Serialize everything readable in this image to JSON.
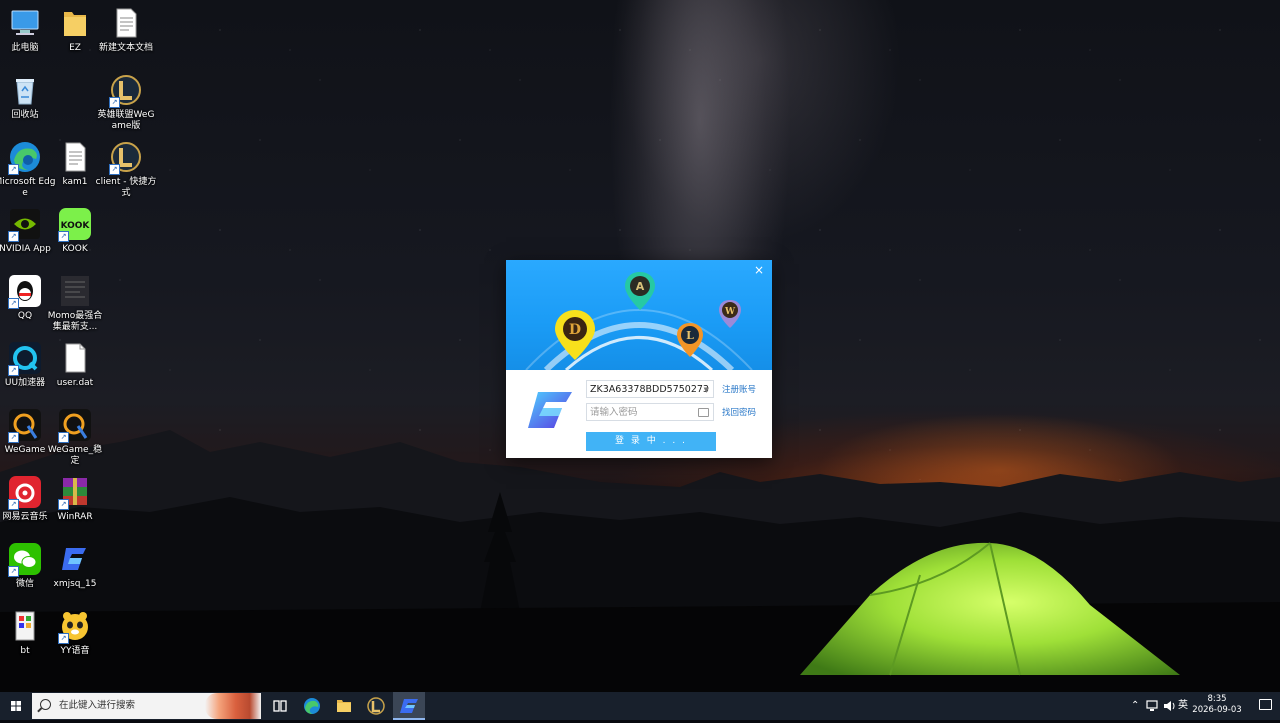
{
  "desktop": {
    "icons": [
      {
        "label": "此电脑",
        "icon": "this-pc-icon"
      },
      {
        "label": "EZ",
        "icon": "folder-icon"
      },
      {
        "label": "新建文本文档",
        "icon": "text-file-icon"
      },
      {
        "label": "回收站",
        "icon": "recycle-bin-icon"
      },
      {
        "label": "英雄联盟WeGame版",
        "icon": "league-of-legends-icon"
      },
      {
        "label": "Microsoft Edge",
        "icon": "edge-icon"
      },
      {
        "label": "kam1",
        "icon": "text-file-icon"
      },
      {
        "label": "client - 快捷方式",
        "icon": "league-client-icon"
      },
      {
        "label": "NVIDIA App",
        "icon": "nvidia-icon"
      },
      {
        "label": "KOOK",
        "icon": "kook-icon"
      },
      {
        "label": "QQ",
        "icon": "qq-icon"
      },
      {
        "label": "Momo最强合集最新支...",
        "icon": "momo-icon"
      },
      {
        "label": "UU加速器",
        "icon": "uu-accelerator-icon"
      },
      {
        "label": "user.dat",
        "icon": "file-icon"
      },
      {
        "label": "WeGame",
        "icon": "wegame-icon"
      },
      {
        "label": "WeGame_稳定",
        "icon": "wegame-stable-icon"
      },
      {
        "label": "网易云音乐",
        "icon": "netease-music-icon"
      },
      {
        "label": "WinRAR",
        "icon": "winrar-icon"
      },
      {
        "label": "微信",
        "icon": "wechat-icon"
      },
      {
        "label": "xmjsq_15",
        "icon": "xmjsq-icon"
      },
      {
        "label": "bt",
        "icon": "bt-icon"
      },
      {
        "label": "YY语音",
        "icon": "yy-voice-icon"
      }
    ]
  },
  "login_dialog": {
    "close_label": "×",
    "banner_pins": [
      "D",
      "A",
      "L",
      "W"
    ],
    "account_value": "ZK3A63378BDD5750273",
    "password_placeholder": "请输入密码",
    "register_link": "注册账号",
    "recover_link": "找回密码",
    "login_button": "登 录 中 . . ."
  },
  "taskbar": {
    "search_placeholder": "在此键入进行搜索",
    "tray_ime": "英",
    "clock_time": "8:35",
    "clock_date": "2026-09-03"
  },
  "colors": {
    "dialog_banner": "#1a9bf5",
    "login_button": "#41b3f6",
    "link": "#2a78c8",
    "taskbar": "#18202c"
  }
}
